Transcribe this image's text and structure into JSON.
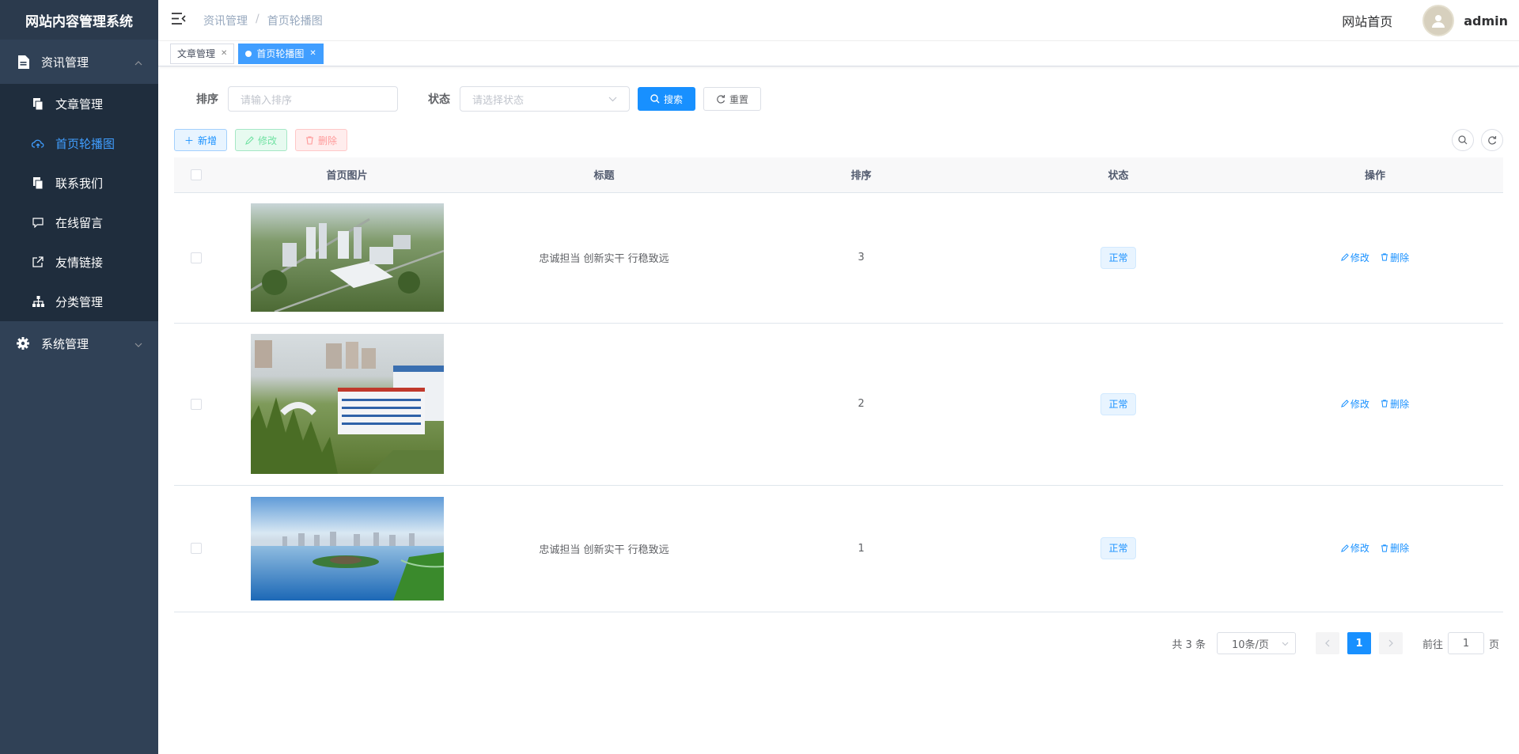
{
  "app": {
    "title": "网站内容管理系统"
  },
  "sidebar": {
    "groups": [
      {
        "label": "资讯管理",
        "expanded": true,
        "icon": "document-icon"
      },
      {
        "label": "系统管理",
        "expanded": false,
        "icon": "gear-icon"
      }
    ],
    "items": [
      {
        "label": "文章管理",
        "icon": "copy-icon",
        "active": false
      },
      {
        "label": "首页轮播图",
        "icon": "cloud-upload-icon",
        "active": true
      },
      {
        "label": "联系我们",
        "icon": "copy-icon",
        "active": false
      },
      {
        "label": "在线留言",
        "icon": "message-icon",
        "active": false
      },
      {
        "label": "友情链接",
        "icon": "external-link-icon",
        "active": false
      },
      {
        "label": "分类管理",
        "icon": "tree-icon",
        "active": false
      }
    ]
  },
  "navbar": {
    "breadcrumb": [
      "资讯管理",
      "首页轮播图"
    ],
    "breadcrumb_sep": "/",
    "home_link": "网站首页",
    "username": "admin"
  },
  "tags": [
    {
      "label": "文章管理",
      "active": false
    },
    {
      "label": "首页轮播图",
      "active": true
    }
  ],
  "search": {
    "sort_label": "排序",
    "sort_placeholder": "请输入排序",
    "status_label": "状态",
    "status_placeholder": "请选择状态",
    "search_button": "搜索",
    "reset_button": "重置"
  },
  "toolbar": {
    "add": "新增",
    "edit": "修改",
    "delete": "删除"
  },
  "table": {
    "headers": {
      "image": "首页图片",
      "title": "标题",
      "sort": "排序",
      "status": "状态",
      "actions": "操作"
    },
    "rows": [
      {
        "image": "aerial-campus-green",
        "title": "忠诚担当 创新实干 行稳致远",
        "sort": "3",
        "status": "正常",
        "edit": "修改",
        "delete": "删除"
      },
      {
        "image": "hospital-building",
        "title": "",
        "sort": "2",
        "status": "正常",
        "edit": "修改",
        "delete": "删除"
      },
      {
        "image": "lake-island-city",
        "title": "忠诚担当 创新实干 行稳致远",
        "sort": "1",
        "status": "正常",
        "edit": "修改",
        "delete": "删除"
      }
    ]
  },
  "pagination": {
    "total_text": "共 3 条",
    "page_size": "10条/页",
    "current_page": "1",
    "goto_prefix": "前往",
    "goto_value": "1",
    "goto_suffix": "页"
  },
  "colors": {
    "primary": "#1890ff",
    "sidebar_bg": "#304156",
    "submenu_bg": "#1f2d3d",
    "active_menu": "#409eff"
  }
}
